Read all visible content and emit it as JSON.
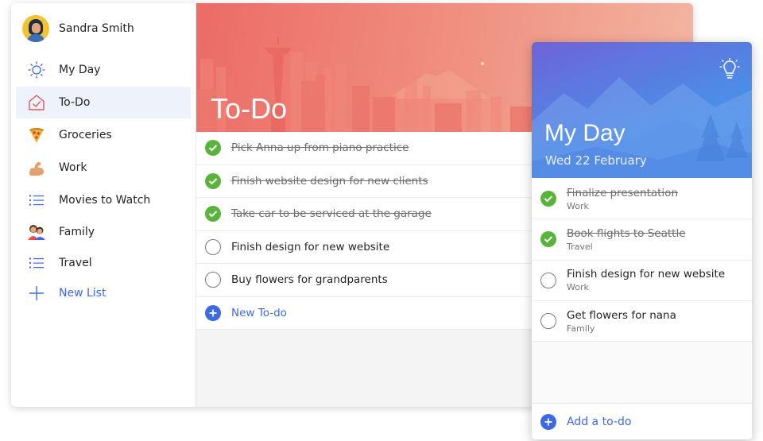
{
  "profile": {
    "name": "Sandra Smith"
  },
  "sidebar": {
    "items": [
      {
        "label": "My Day",
        "icon": "sun-icon"
      },
      {
        "label": "To-Do",
        "icon": "home-check-icon",
        "active": true
      },
      {
        "label": "Groceries",
        "icon": "pizza-icon"
      },
      {
        "label": "Work",
        "icon": "flexed-arm-icon"
      },
      {
        "label": "Movies to Watch",
        "icon": "list-icon"
      },
      {
        "label": "Family",
        "icon": "family-icon"
      },
      {
        "label": "Travel",
        "icon": "list-icon"
      },
      {
        "label": "New List",
        "icon": "plus-icon"
      }
    ]
  },
  "todo": {
    "title": "To-Do",
    "tasks": [
      {
        "text": "Pick Anna up from piano practice",
        "done": true
      },
      {
        "text": "Finish website design for new clients",
        "done": true
      },
      {
        "text": "Take car to be serviced at the garage",
        "done": true
      },
      {
        "text": "Finish design for new website",
        "done": false
      },
      {
        "text": "Buy flowers for grandparents",
        "done": false
      }
    ],
    "new_label": "New To-do"
  },
  "myday": {
    "title": "My Day",
    "date": "Wed 22 February",
    "tasks": [
      {
        "title": "Finalize presentation",
        "list": "Work",
        "done": true
      },
      {
        "title": "Book flights to Seattle",
        "list": "Travel",
        "done": true
      },
      {
        "title": "Finish design for new website",
        "list": "Work",
        "done": false
      },
      {
        "title": "Get flowers for nana",
        "list": "Family",
        "done": false
      }
    ],
    "add_label": "Add a to-do"
  },
  "colors": {
    "accent": "#3e69e4",
    "check_done": "#5ab43b",
    "todo_hero": "#ec6b66",
    "myday_hero": "#4d8be6"
  }
}
